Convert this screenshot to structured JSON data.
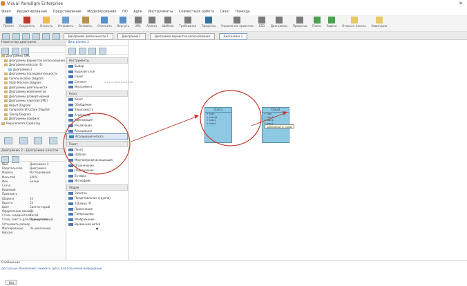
{
  "app": {
    "title": "Visual Paradigm Enterprise"
  },
  "menu": [
    "Файл",
    "Редактирование",
    "Представление",
    "Моделирование",
    "ПО",
    "Agile",
    "Инструменты",
    "Совместная работа",
    "Окно",
    "Помощь"
  ],
  "ribbon": [
    "Проект",
    "Сохранить",
    "Открыть",
    "Отправить",
    "Вставить",
    "Отменить",
    "Вернуть",
    "UML",
    "Анализ",
    "Шаблон",
    "Требования",
    "Процессы",
    "Управление проектом",
    "ERD",
    "Диаграммы",
    "Процессы",
    "Поиск",
    "Задачи",
    "Открыть панель",
    "Навигация"
  ],
  "tabs": [
    "Диаграмма деятельности 1",
    "Диаграмма 1",
    "Диаграмма вариантов использования",
    "Диаграмма 2"
  ],
  "left": {
    "header": "Навигатор диаграмм",
    "tree": [
      "Диаграммы UML",
      "Диаграммы вариантов использования",
      "Диаграмма классов (1)",
      "Диаграмма 2",
      "Диаграммы последовательности",
      "Communication Diagram",
      "State Machine Diagram",
      "Диаграммы деятельности",
      "Диаграммы компонентов",
      "Диаграммы развертывания",
      "Диаграммы пакетов (UML)",
      "Object Diagram",
      "Composite Structure Diagram",
      "Timing Diagram",
      "Диаграммы профиля",
      "Requirements Capturing"
    ],
    "props_header": "Диаграмма 2 - Диаграмма классов",
    "props": [
      {
        "k": "Имя",
        "v": "Диаграмма 2"
      },
      {
        "k": "Родительская",
        "v": "Диаграмма"
      },
      {
        "k": "Модель",
        "v": "Исследование"
      },
      {
        "k": "Масштаб",
        "v": "100%"
      },
      {
        "k": "Фон",
        "v": "Белый"
      },
      {
        "k": "Сетка",
        "v": ""
      },
      {
        "k": "Видимый",
        "v": ""
      },
      {
        "k": "Привязать",
        "v": ""
      },
      {
        "k": "Ширина",
        "v": "10"
      },
      {
        "k": "Высота",
        "v": "10"
      },
      {
        "k": "Цвет",
        "v": "Светло-серый"
      },
      {
        "k": "Оформление связи",
        "v": "Да"
      },
      {
        "k": "Стиль соединителя",
        "v": "Косой"
      },
      {
        "k": "Стиль текста для соединителя",
        "v": "Прямоугольный"
      },
      {
        "k": "Установить размер",
        "v": ""
      },
      {
        "k": "Маскирование",
        "v": "По умолчанию"
      },
      {
        "k": "Версия",
        "v": ""
      }
    ]
  },
  "palette": {
    "header": "Диаграмма 2",
    "groups": [
      {
        "label": "Инструменты",
        "items": [
          "Выбор",
          "Выделить все",
          "Сдвиг",
          "Сегмент",
          "Инструмент"
        ]
      },
      {
        "label": "Класс",
        "items": [
          "Класс",
          "Обобщение",
          "Зависимость",
          "Агрегация",
          "Композиция",
          "Реализация",
          "Ассоциация",
          "Ассоциация класса"
        ]
      },
      {
        "label": "Пакет",
        "items": [
          "Пакет",
          "Шаблон",
          "Многомерная ассоциация",
          "Ограничение",
          "Пересечение",
          "Вставка",
          "Интерфейс"
        ]
      },
      {
        "label": "Общее",
        "items": [
          "Заметка",
          "Представление (группа)",
          "Таблица ПТ",
          "Примечание",
          "Гиперссылка",
          "Изображение",
          "Временная метка"
        ]
      }
    ]
  },
  "canvas": {
    "class1": {
      "name": "Class1",
      "attrs": [
        "+ Ivan",
        "+ IvanSt",
        "+ Ivan1",
        "+ Ivan2"
      ]
    },
    "class2": {
      "name": "Class2",
      "attrs": [
        "+ Ivan",
        "+ IvanSt",
        "+ Ivan1",
        "+ Ivan2"
      ]
    },
    "tooltip": "Зависимость: Class1"
  },
  "output": {
    "header": "Сообщение",
    "text": "Доступные обновления: нажмите здесь для получения информации",
    "tab": "Все"
  }
}
